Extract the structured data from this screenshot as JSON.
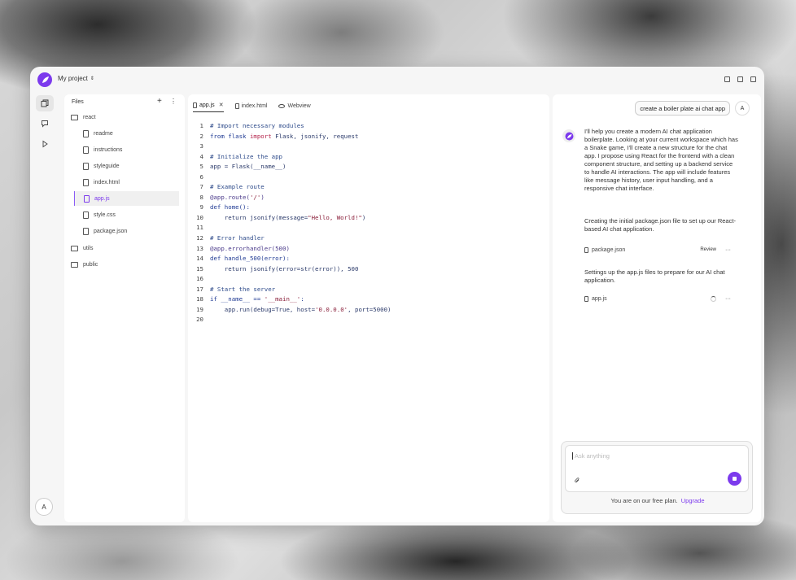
{
  "window": {
    "project_name": "My project",
    "project_chevron": "⌃⌄"
  },
  "rail": {
    "items": [
      {
        "name": "files-icon",
        "active": true
      },
      {
        "name": "chat-icon",
        "active": false
      },
      {
        "name": "play-icon",
        "active": false
      }
    ],
    "avatar": "A"
  },
  "files": {
    "header": "Files",
    "add": "+",
    "more": "⋮",
    "tree": [
      {
        "label": "react",
        "type": "folder"
      },
      {
        "label": "readme",
        "type": "file"
      },
      {
        "label": "instructions",
        "type": "file"
      },
      {
        "label": "styleguide",
        "type": "file"
      },
      {
        "label": "index.html",
        "type": "file"
      },
      {
        "label": "app.js",
        "type": "file",
        "selected": true
      },
      {
        "label": "style.css",
        "type": "file"
      },
      {
        "label": "package.json",
        "type": "file"
      },
      {
        "label": "utils",
        "type": "folder"
      },
      {
        "label": "public",
        "type": "folder"
      }
    ]
  },
  "editor": {
    "tabs": [
      {
        "label": "app.js",
        "close": "✕",
        "active": true
      },
      {
        "label": "index.html"
      },
      {
        "label": "Webview"
      }
    ],
    "code_lines": [
      "1",
      "2",
      "3",
      "4",
      "5",
      "6",
      "7",
      "8",
      "9",
      "10",
      "11",
      "12",
      "13",
      "14",
      "15",
      "16",
      "17",
      "18",
      "19",
      "20"
    ],
    "code": {
      "l1": "# Import necessary modules",
      "l2a": "from flask ",
      "l2b": "import",
      "l2c": " Flask, jsonify, request",
      "l4": "# Initialize the app",
      "l5": "app = Flask(__name__)",
      "l7": "# Example route",
      "l8a": "@app.route(",
      "l8b": "'/'",
      "l8c": ")",
      "l9": "def home():",
      "l10a": "    return jsonify(message=",
      "l10b": "\"Hello, World!\"",
      "l10c": ")",
      "l12": "# Error handler",
      "l13": "@app.errorhandler(500)",
      "l14": "def handle_500(error):",
      "l15": "    return jsonify(error=str(error)), 500",
      "l17": "# Start the server",
      "l18a": "if __name__ == ",
      "l18b": "'__main__'",
      "l18c": ":",
      "l19a": "    app.run(debug=True, host=",
      "l19b": "'0.0.0.0'",
      "l19c": ", port=5000)"
    }
  },
  "chat": {
    "user_message": "create a boiler plate ai chat app",
    "user_avatar": "A",
    "ai_paragraph_1": "I'll help you create a modern AI chat application boilerplate. Looking at your current workspace which has a Snake game, I'll create a new structure for the chat app. I propose using React for the frontend with a clean component structure, and setting up a backend service to handle AI interactions. The app will include features like message history, user input handling, and a responsive chat interface.",
    "ai_paragraph_2": "Creating the initial package.json file to set up our React-based AI chat application.",
    "file_1": "package.json",
    "file_1_action": "Review",
    "file_menu": "···",
    "ai_paragraph_3": "Settings up the app.js files to prepare for our AI chat application.",
    "file_2": "app.js",
    "composer": {
      "placeholder": "Ask anything",
      "plan_text": "You are on our free plan.",
      "upgrade": "Upgrade"
    }
  },
  "colors": {
    "accent": "#7c3aed"
  }
}
